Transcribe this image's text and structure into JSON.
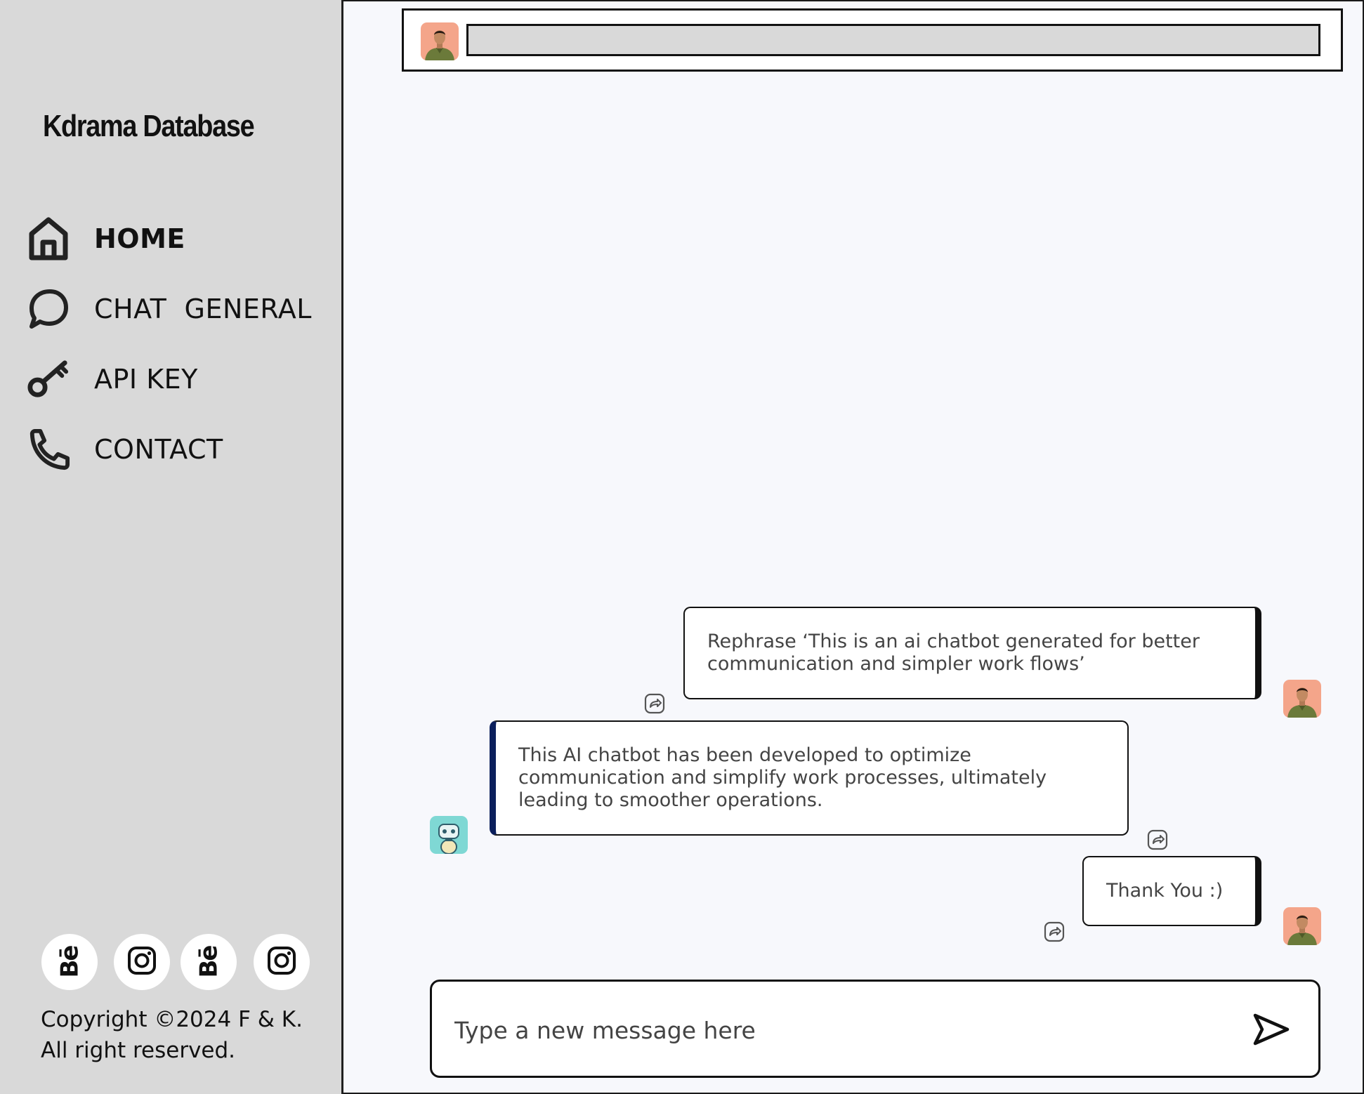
{
  "sidebar": {
    "brand": "Kdrama Database",
    "nav": [
      {
        "label": "HOME",
        "icon": "home-icon",
        "active": true
      },
      {
        "label": "CHAT  GENERAL",
        "icon": "chat-bubble-icon",
        "active": false
      },
      {
        "label": "API KEY",
        "icon": "key-icon",
        "active": false
      },
      {
        "label": "CONTACT",
        "icon": "phone-icon",
        "active": false
      }
    ],
    "socials": [
      "behance-icon",
      "instagram-icon",
      "behance-icon",
      "instagram-icon"
    ],
    "behance_text": "Bē",
    "copyright": "Copyright ©2024 F & K. All right reserved."
  },
  "topbar": {
    "avatar": "user-avatar",
    "input_value": ""
  },
  "messages": [
    {
      "sender": "user",
      "text": "Rephrase ‘This is an ai chatbot generated for better communication and simpler work flows’"
    },
    {
      "sender": "bot",
      "text": "This AI chatbot has been developed to optimize communication and simplify work processes, ultimately leading to smoother operations."
    },
    {
      "sender": "user",
      "text": "Thank You :)"
    }
  ],
  "composer": {
    "placeholder": "Type a new message here",
    "send_icon": "send-icon"
  },
  "colors": {
    "sidebar_bg": "#d9d9d9",
    "main_bg": "#f7f8fc",
    "bot_accent": "#0b1f5c",
    "avatar_user_bg": "#f4a58a",
    "avatar_bot_bg": "#7fd8d4"
  }
}
